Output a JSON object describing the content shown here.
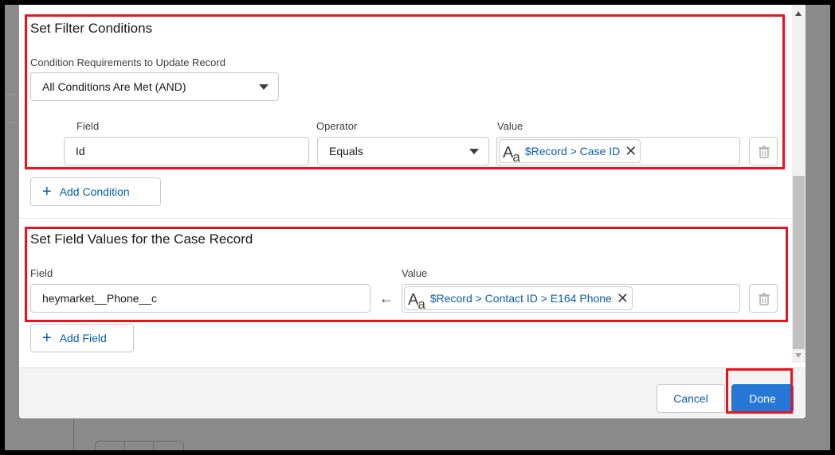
{
  "filter_section": {
    "title": "Set Filter Conditions",
    "requirement_label": "Condition Requirements to Update Record",
    "requirement_value": "All Conditions Are Met (AND)",
    "field_label": "Field",
    "operator_label": "Operator",
    "value_label": "Value",
    "field_value": "Id",
    "operator_value": "Equals",
    "value_pill": "$Record > Case ID",
    "add_condition_label": "Add Condition"
  },
  "field_values_section": {
    "title": "Set Field Values for the Case Record",
    "field_label": "Field",
    "value_label": "Value",
    "field_value": "heymarket__Phone__c",
    "value_pill": "$Record > Contact ID > E164 Phone",
    "add_field_label": "Add Field"
  },
  "icons": {
    "text_type": "text-type-icon",
    "clear": "close-icon",
    "delete": "trash-icon",
    "add": "plus-icon",
    "map_to": "arrow-left-icon",
    "dropdown": "chevron-down-icon"
  },
  "footer": {
    "cancel_label": "Cancel",
    "done_label": "Done"
  },
  "colors": {
    "brand": "#2677d6",
    "link": "#0b5cab",
    "highlight": "#e8141d"
  }
}
